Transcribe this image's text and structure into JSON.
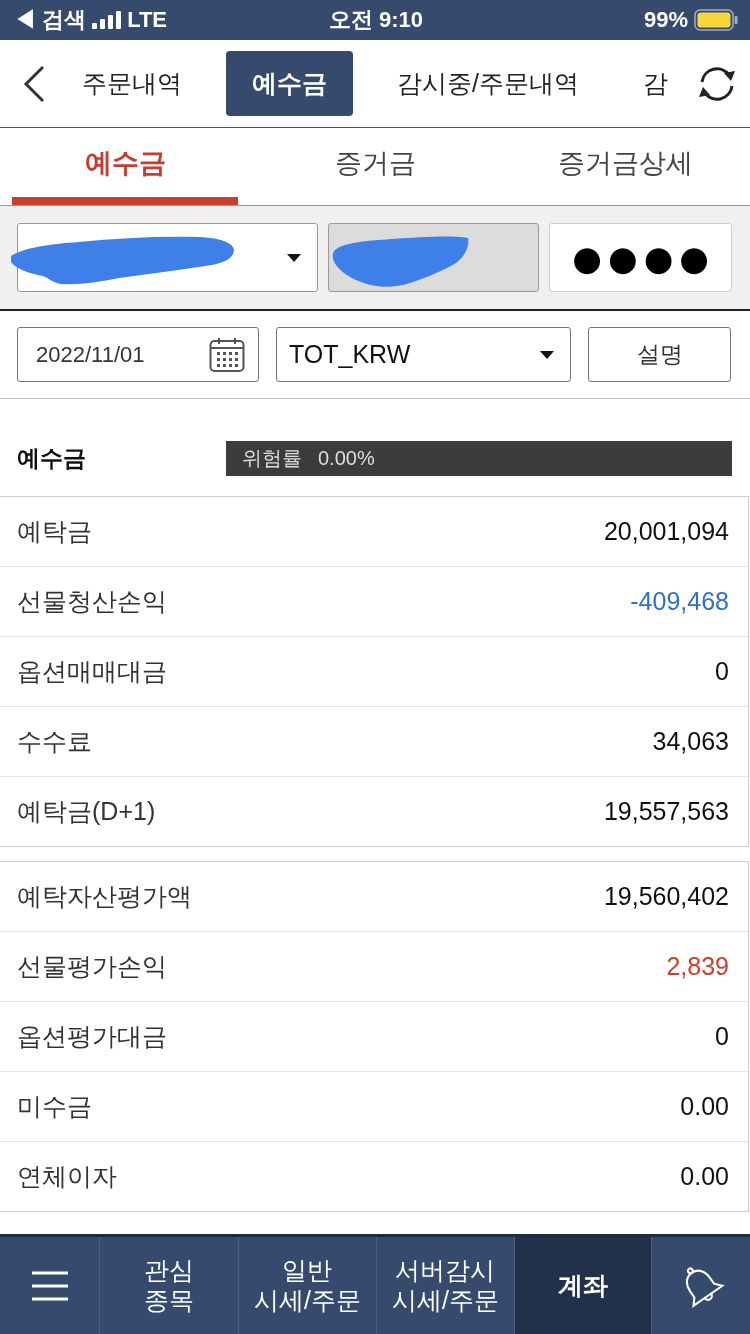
{
  "status_bar": {
    "back_link": "◀ 검색",
    "network": "LTE",
    "time": "오전 9:10",
    "battery": "99%"
  },
  "top_tabs": [
    {
      "label": "주문내역",
      "selected": false
    },
    {
      "label": "예수금",
      "selected": true
    },
    {
      "label": "감시중/주문내역",
      "selected": false
    },
    {
      "label": "감",
      "selected": false
    }
  ],
  "sub_tabs": [
    {
      "label": "예수금",
      "selected": true
    },
    {
      "label": "증거금",
      "selected": false
    },
    {
      "label": "증거금상세",
      "selected": false
    }
  ],
  "account": {
    "account_select": {
      "redacted": true
    },
    "readonly_field": {
      "redacted": true
    },
    "password_field": {
      "value": "●●●●"
    }
  },
  "filters": {
    "date": "2022/11/01",
    "currency": "TOT_KRW",
    "help_button": "설명"
  },
  "summary": {
    "title": "예수금",
    "risk_label": "위험률",
    "risk_value": "0.00%"
  },
  "tables": [
    {
      "rows": [
        {
          "label": "예탁금",
          "value": "20,001,094",
          "color": "#111111"
        },
        {
          "label": "선물청산손익",
          "value": "-409,468",
          "color": "#2f6fd0"
        },
        {
          "label": "옵션매매대금",
          "value": "0",
          "color": "#111111"
        },
        {
          "label": "수수료",
          "value": "34,063",
          "color": "#111111"
        },
        {
          "label": "예탁금(D+1)",
          "value": "19,557,563",
          "color": "#111111"
        }
      ]
    },
    {
      "rows": [
        {
          "label": "예탁자산평가액",
          "value": "19,560,402",
          "color": "#111111"
        },
        {
          "label": "선물평가손익",
          "value": "2,839",
          "color": "#c8402f"
        },
        {
          "label": "옵션평가대금",
          "value": "0",
          "color": "#111111"
        },
        {
          "label": "미수금",
          "value": "0.00",
          "color": "#111111"
        },
        {
          "label": "연체이자",
          "value": "0.00",
          "color": "#111111"
        }
      ]
    }
  ],
  "bottom_nav": [
    {
      "kind": "menu",
      "selected": false
    },
    {
      "kind": "tab",
      "label": "관심\n종목",
      "selected": false
    },
    {
      "kind": "tab",
      "label": "일반\n시세/주문",
      "selected": false
    },
    {
      "kind": "tab",
      "label": "서버감시\n시세/주문",
      "selected": false
    },
    {
      "kind": "tab",
      "label": "계좌",
      "selected": true
    },
    {
      "kind": "bell",
      "selected": false
    }
  ]
}
